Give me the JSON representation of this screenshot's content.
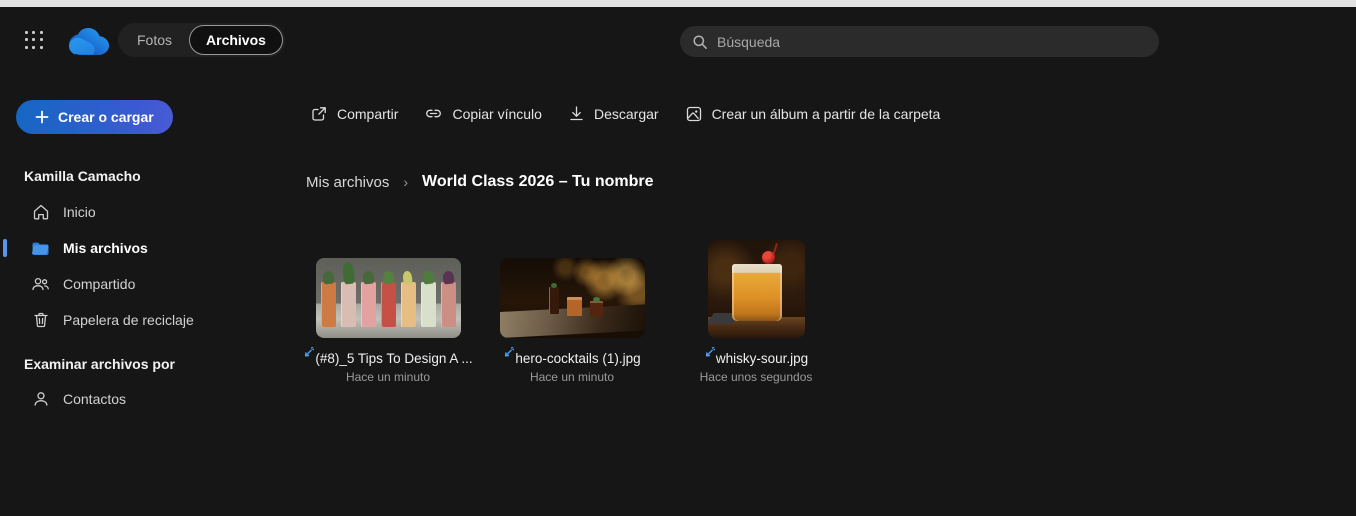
{
  "topbar": {
    "tabs": [
      {
        "label": "Fotos"
      },
      {
        "label": "Archivos"
      }
    ],
    "search": {
      "placeholder": "Búsqueda"
    }
  },
  "sidebar": {
    "create_button_label": "Crear o cargar",
    "user_name": "Kamilla Camacho",
    "nav": [
      {
        "label": "Inicio",
        "icon": "home-icon"
      },
      {
        "label": "Mis archivos",
        "icon": "folder-icon"
      },
      {
        "label": "Compartido",
        "icon": "people-icon"
      },
      {
        "label": "Papelera de reciclaje",
        "icon": "trash-icon"
      }
    ],
    "section_header": "Examinar archivos por",
    "section_nav": [
      {
        "label": "Contactos",
        "icon": "person-icon"
      }
    ]
  },
  "toolbar": {
    "items": [
      {
        "label": "Compartir",
        "icon": "share-icon"
      },
      {
        "label": "Copiar vínculo",
        "icon": "link-icon"
      },
      {
        "label": "Descargar",
        "icon": "download-icon"
      },
      {
        "label": "Crear un álbum a partir de la carpeta",
        "icon": "album-icon"
      }
    ]
  },
  "breadcrumb": {
    "parent": "Mis archivos",
    "separator": "›",
    "current": "World Class 2026 – Tu nombre"
  },
  "files": [
    {
      "name": "(#8)_5 Tips To Design A ...",
      "time": "Hace un minuto",
      "thumbnail": "cocktail-lineup-photo",
      "badge": "recently-added"
    },
    {
      "name": "hero-cocktails (1).jpg",
      "time": "Hace un minuto",
      "thumbnail": "dark-bar-cocktails-photo",
      "badge": "recently-added"
    },
    {
      "name": "whisky-sour.jpg",
      "time": "Hace unos segundos",
      "thumbnail": "whisky-sour-photo",
      "badge": "recently-added"
    }
  ],
  "colors": {
    "background": "#161616",
    "accent_blue": "#4795e8",
    "create_button_gradient_start": "#1467c2",
    "create_button_gradient_end": "#4a5bd6",
    "new_badge_blue": "#4f9cf5"
  }
}
